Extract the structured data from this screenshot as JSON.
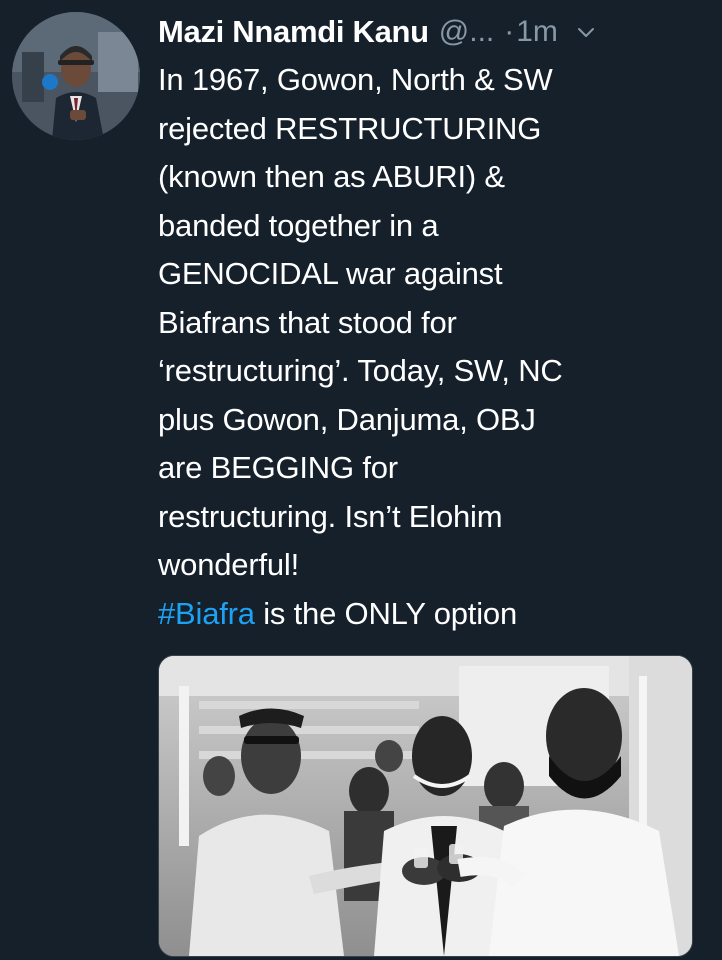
{
  "tweet": {
    "author": {
      "name": "Mazi Nnamdi Kanu",
      "handle": "@...",
      "separator": "·",
      "time": "1m"
    },
    "icons": {
      "avatar": "profile-photo",
      "menu": "chevron-down-icon"
    },
    "text_lines": [
      "In 1967, Gowon, North & SW",
      "rejected RESTRUCTURING",
      "(known then as ABURI) &",
      "banded together in a",
      "GENOCIDAL war against",
      "Biafrans that stood for",
      "‘restructuring’. Today, SW, NC",
      "plus Gowon, Danjuma, OBJ",
      "are BEGGING for",
      "restructuring. Isn’t Elohim",
      "wonderful!"
    ],
    "last_line": {
      "hashtag": "#Biafra",
      "rest": " is the ONLY option"
    },
    "media": {
      "kind": "black-and-white photo"
    }
  },
  "colors": {
    "background": "#15202b",
    "text": "#ffffff",
    "secondary_text": "#8899a6",
    "link": "#1da1f2"
  }
}
